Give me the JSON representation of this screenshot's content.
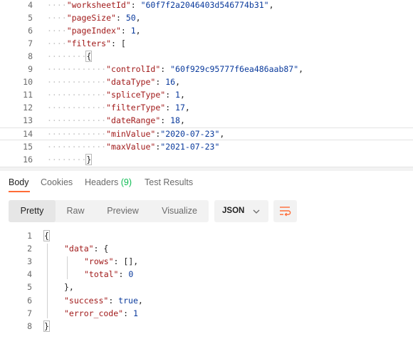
{
  "request_body": {
    "lines": [
      {
        "n": "4",
        "indent": 2,
        "tokens": [
          {
            "t": "\"worksheetId\"",
            "c": "key"
          },
          {
            "t": ": ",
            "c": "pun"
          },
          {
            "t": "\"60f7f2a2046403d546774b31\"",
            "c": "str"
          },
          {
            "t": ",",
            "c": "pun"
          }
        ]
      },
      {
        "n": "5",
        "indent": 2,
        "tokens": [
          {
            "t": "\"pageSize\"",
            "c": "key"
          },
          {
            "t": ": ",
            "c": "pun"
          },
          {
            "t": "50",
            "c": "num"
          },
          {
            "t": ",",
            "c": "pun"
          }
        ]
      },
      {
        "n": "6",
        "indent": 2,
        "tokens": [
          {
            "t": "\"pageIndex\"",
            "c": "key"
          },
          {
            "t": ": ",
            "c": "pun"
          },
          {
            "t": "1",
            "c": "num"
          },
          {
            "t": ",",
            "c": "pun"
          }
        ]
      },
      {
        "n": "7",
        "indent": 2,
        "tokens": [
          {
            "t": "\"filters\"",
            "c": "key"
          },
          {
            "t": ": [",
            "c": "pun"
          }
        ]
      },
      {
        "n": "8",
        "indent": 4,
        "tokens": [
          {
            "t": "{",
            "c": "pun",
            "box": true
          }
        ]
      },
      {
        "n": "9",
        "indent": 6,
        "tokens": [
          {
            "t": "\"controlId\"",
            "c": "key"
          },
          {
            "t": ": ",
            "c": "pun"
          },
          {
            "t": "\"60f929c95777f6ea486aab87\"",
            "c": "str"
          },
          {
            "t": ",",
            "c": "pun"
          }
        ]
      },
      {
        "n": "10",
        "indent": 6,
        "tokens": [
          {
            "t": "\"dataType\"",
            "c": "key"
          },
          {
            "t": ": ",
            "c": "pun"
          },
          {
            "t": "16",
            "c": "num"
          },
          {
            "t": ",",
            "c": "pun"
          }
        ]
      },
      {
        "n": "11",
        "indent": 6,
        "tokens": [
          {
            "t": "\"spliceType\"",
            "c": "key"
          },
          {
            "t": ": ",
            "c": "pun"
          },
          {
            "t": "1",
            "c": "num"
          },
          {
            "t": ",",
            "c": "pun"
          }
        ]
      },
      {
        "n": "12",
        "indent": 6,
        "tokens": [
          {
            "t": "\"filterType\"",
            "c": "key"
          },
          {
            "t": ": ",
            "c": "pun"
          },
          {
            "t": "17",
            "c": "num"
          },
          {
            "t": ",",
            "c": "pun"
          }
        ]
      },
      {
        "n": "13",
        "indent": 6,
        "tokens": [
          {
            "t": "\"dateRange\"",
            "c": "key"
          },
          {
            "t": ": ",
            "c": "pun"
          },
          {
            "t": "18",
            "c": "num"
          },
          {
            "t": ",",
            "c": "pun"
          }
        ]
      },
      {
        "n": "14",
        "indent": 6,
        "current": true,
        "tokens": [
          {
            "t": "\"minValue\"",
            "c": "key"
          },
          {
            "t": ":",
            "c": "pun"
          },
          {
            "t": "\"2020-07-23\"",
            "c": "str"
          },
          {
            "t": ",",
            "c": "pun"
          }
        ]
      },
      {
        "n": "15",
        "indent": 6,
        "tokens": [
          {
            "t": "\"maxValue\"",
            "c": "key"
          },
          {
            "t": ":",
            "c": "pun"
          },
          {
            "t": "\"2021-07-23\"",
            "c": "str"
          }
        ]
      },
      {
        "n": "16",
        "indent": 4,
        "tokens": [
          {
            "t": "}",
            "c": "pun",
            "box": true
          }
        ]
      }
    ]
  },
  "response_tabs": {
    "body": "Body",
    "cookies": "Cookies",
    "headers": "Headers",
    "headers_count": "(9)",
    "test_results": "Test Results",
    "active": "Body",
    "accent_color": "#ff6c37",
    "count_color": "#0cbb52"
  },
  "toolbar": {
    "views": [
      "Pretty",
      "Raw",
      "Preview",
      "Visualize"
    ],
    "active_view": "Pretty",
    "format": "JSON",
    "format_icon": "chevron-down-icon",
    "wrap_icon": "wrap-lines-icon"
  },
  "response_body": {
    "lines": [
      {
        "n": "1",
        "indent": 0,
        "tokens": [
          {
            "t": "{",
            "c": "pun",
            "box": true
          }
        ]
      },
      {
        "n": "2",
        "indent": 1,
        "tokens": [
          {
            "t": "\"data\"",
            "c": "key"
          },
          {
            "t": ": {",
            "c": "pun"
          }
        ]
      },
      {
        "n": "3",
        "indent": 2,
        "tokens": [
          {
            "t": "\"rows\"",
            "c": "key"
          },
          {
            "t": ": [],",
            "c": "pun"
          }
        ]
      },
      {
        "n": "4",
        "indent": 2,
        "tokens": [
          {
            "t": "\"total\"",
            "c": "key"
          },
          {
            "t": ": ",
            "c": "pun"
          },
          {
            "t": "0",
            "c": "num"
          }
        ]
      },
      {
        "n": "5",
        "indent": 1,
        "tokens": [
          {
            "t": "},",
            "c": "pun"
          }
        ]
      },
      {
        "n": "6",
        "indent": 1,
        "tokens": [
          {
            "t": "\"success\"",
            "c": "key"
          },
          {
            "t": ": ",
            "c": "pun"
          },
          {
            "t": "true",
            "c": "num"
          },
          {
            "t": ",",
            "c": "pun"
          }
        ]
      },
      {
        "n": "7",
        "indent": 1,
        "tokens": [
          {
            "t": "\"error_code\"",
            "c": "key"
          },
          {
            "t": ": ",
            "c": "pun"
          },
          {
            "t": "1",
            "c": "num"
          }
        ]
      },
      {
        "n": "8",
        "indent": 0,
        "tokens": [
          {
            "t": "}",
            "c": "pun",
            "box": true
          }
        ]
      }
    ]
  }
}
